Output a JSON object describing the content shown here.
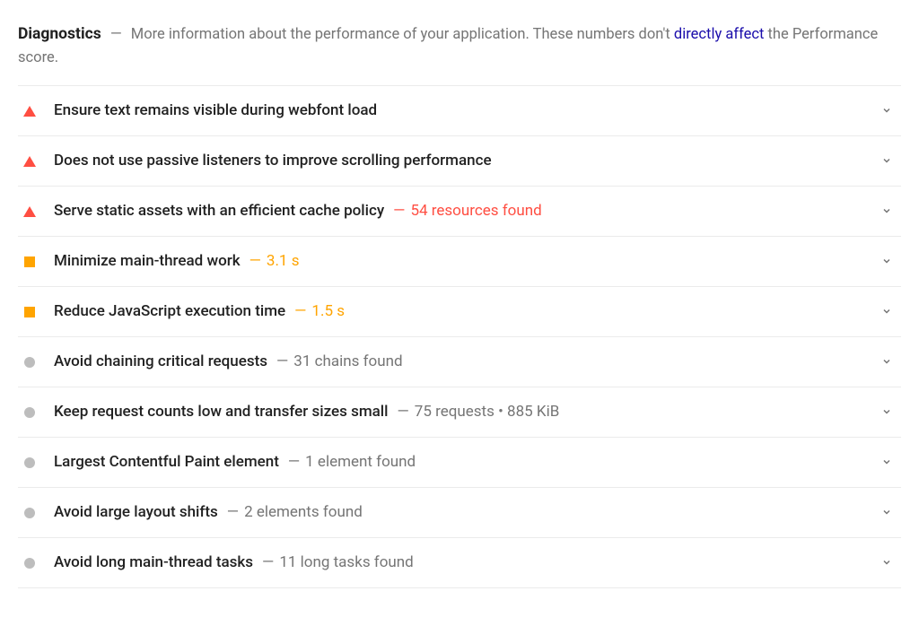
{
  "header": {
    "title": "Diagnostics",
    "description_before_link": "More information about the performance of your application. These numbers don't ",
    "link_text": "directly affect",
    "description_after_link": " the Performance score."
  },
  "audits": [
    {
      "severity": "fail",
      "title": "Ensure text remains visible during webfont load",
      "detail": ""
    },
    {
      "severity": "fail",
      "title": "Does not use passive listeners to improve scrolling performance",
      "detail": ""
    },
    {
      "severity": "fail",
      "title": "Serve static assets with an efficient cache policy",
      "detail": "54 resources found"
    },
    {
      "severity": "average",
      "title": "Minimize main-thread work",
      "detail": "3.1 s"
    },
    {
      "severity": "average",
      "title": "Reduce JavaScript execution time",
      "detail": "1.5 s"
    },
    {
      "severity": "info",
      "title": "Avoid chaining critical requests",
      "detail": "31 chains found"
    },
    {
      "severity": "info",
      "title": "Keep request counts low and transfer sizes small",
      "detail": "75 requests • 885 KiB"
    },
    {
      "severity": "info",
      "title": "Largest Contentful Paint element",
      "detail": "1 element found"
    },
    {
      "severity": "info",
      "title": "Avoid large layout shifts",
      "detail": "2 elements found"
    },
    {
      "severity": "info",
      "title": "Avoid long main-thread tasks",
      "detail": "11 long tasks found"
    }
  ]
}
